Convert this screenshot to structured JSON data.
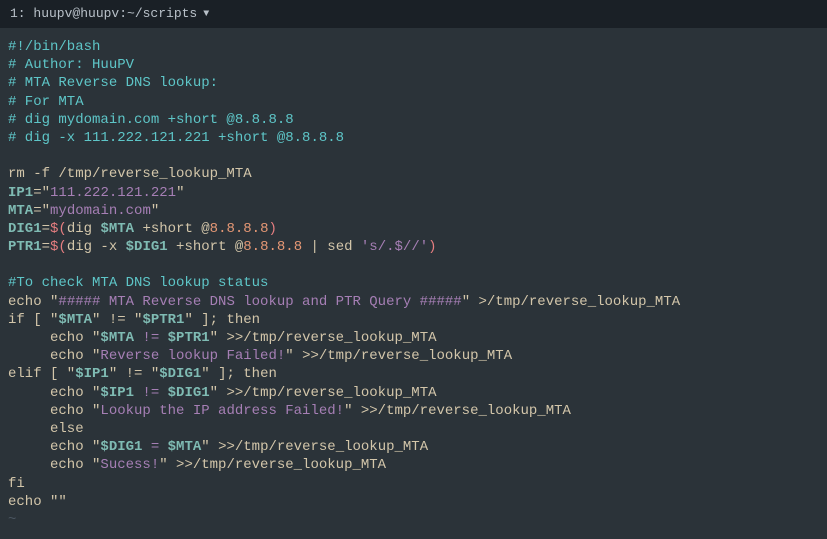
{
  "titlebar": {
    "label": "1: huupv@huupv:~/scripts"
  },
  "code": {
    "l1": "#!/bin/bash",
    "l2": "# Author: HuuPV",
    "l3": "# MTA Reverse DNS lookup:",
    "l4": "# For MTA",
    "l5": "# dig mydomain.com +short @8.8.8.8",
    "l6": "# dig -x 111.222.121.221 +short @8.8.8.8",
    "l7_a": "rm -f /tmp/reverse_lookup_MTA",
    "l8_var": "IP1",
    "l8_eq": "=\"",
    "l8_val": "111.222.121.221",
    "l8_end": "\"",
    "l9_var": "MTA",
    "l9_eq": "=\"",
    "l9_val": "mydomain.com",
    "l9_end": "\"",
    "l10_var": "DIG1",
    "l10_eq": "=",
    "l10_sub1": "$(",
    "l10_dig": "dig ",
    "l10_mta": "$MTA",
    "l10_short": " +short @",
    "l10_ip": "8.8.8.8",
    "l10_sub2": ")",
    "l11_var": "PTR1",
    "l11_eq": "=",
    "l11_sub1": "$(",
    "l11_dig": "dig -x ",
    "l11_dig1": "$DIG1",
    "l11_short": " +short @",
    "l11_ip": "8.8.8.8",
    "l11_pipe": " | sed ",
    "l11_sed": "'s/.$//'",
    "l11_sub2": ")",
    "l13": "#To check MTA DNS lookup status",
    "l14_a": "echo \"",
    "l14_b": "##### MTA Reverse DNS lookup and PTR Query #####",
    "l14_c": "\" >/tmp/reverse_lookup_MTA",
    "l15_a": "if [ \"",
    "l15_b": "$MTA",
    "l15_c": "\" != \"",
    "l15_d": "$PTR1",
    "l15_e": "\" ]; then",
    "l16_a": "     echo \"",
    "l16_b": "$MTA",
    "l16_c": " != ",
    "l16_d": "$PTR1",
    "l16_e": "\" >>/tmp/reverse_lookup_MTA",
    "l17_a": "     echo \"",
    "l17_b": "Reverse lookup Failed!",
    "l17_c": "\" >>/tmp/reverse_lookup_MTA",
    "l18_a": "elif [ \"",
    "l18_b": "$IP1",
    "l18_c": "\" != \"",
    "l18_d": "$DIG1",
    "l18_e": "\" ]; then",
    "l19_a": "     echo \"",
    "l19_b": "$IP1",
    "l19_c": " != ",
    "l19_d": "$DIG1",
    "l19_e": "\" >>/tmp/reverse_lookup_MTA",
    "l20_a": "     echo \"",
    "l20_b": "Lookup the IP address Failed!",
    "l20_c": "\" >>/tmp/reverse_lookup_MTA",
    "l21": "     else",
    "l22_a": "     echo \"",
    "l22_b": "$DIG1",
    "l22_c": " = ",
    "l22_d": "$MTA",
    "l22_e": "\" >>/tmp/reverse_lookup_MTA",
    "l23_a": "     echo \"",
    "l23_b": "Sucess!",
    "l23_c": "\" >>/tmp/reverse_lookup_MTA",
    "l24": "fi",
    "l25": "echo \"\"",
    "tilde": "~"
  }
}
